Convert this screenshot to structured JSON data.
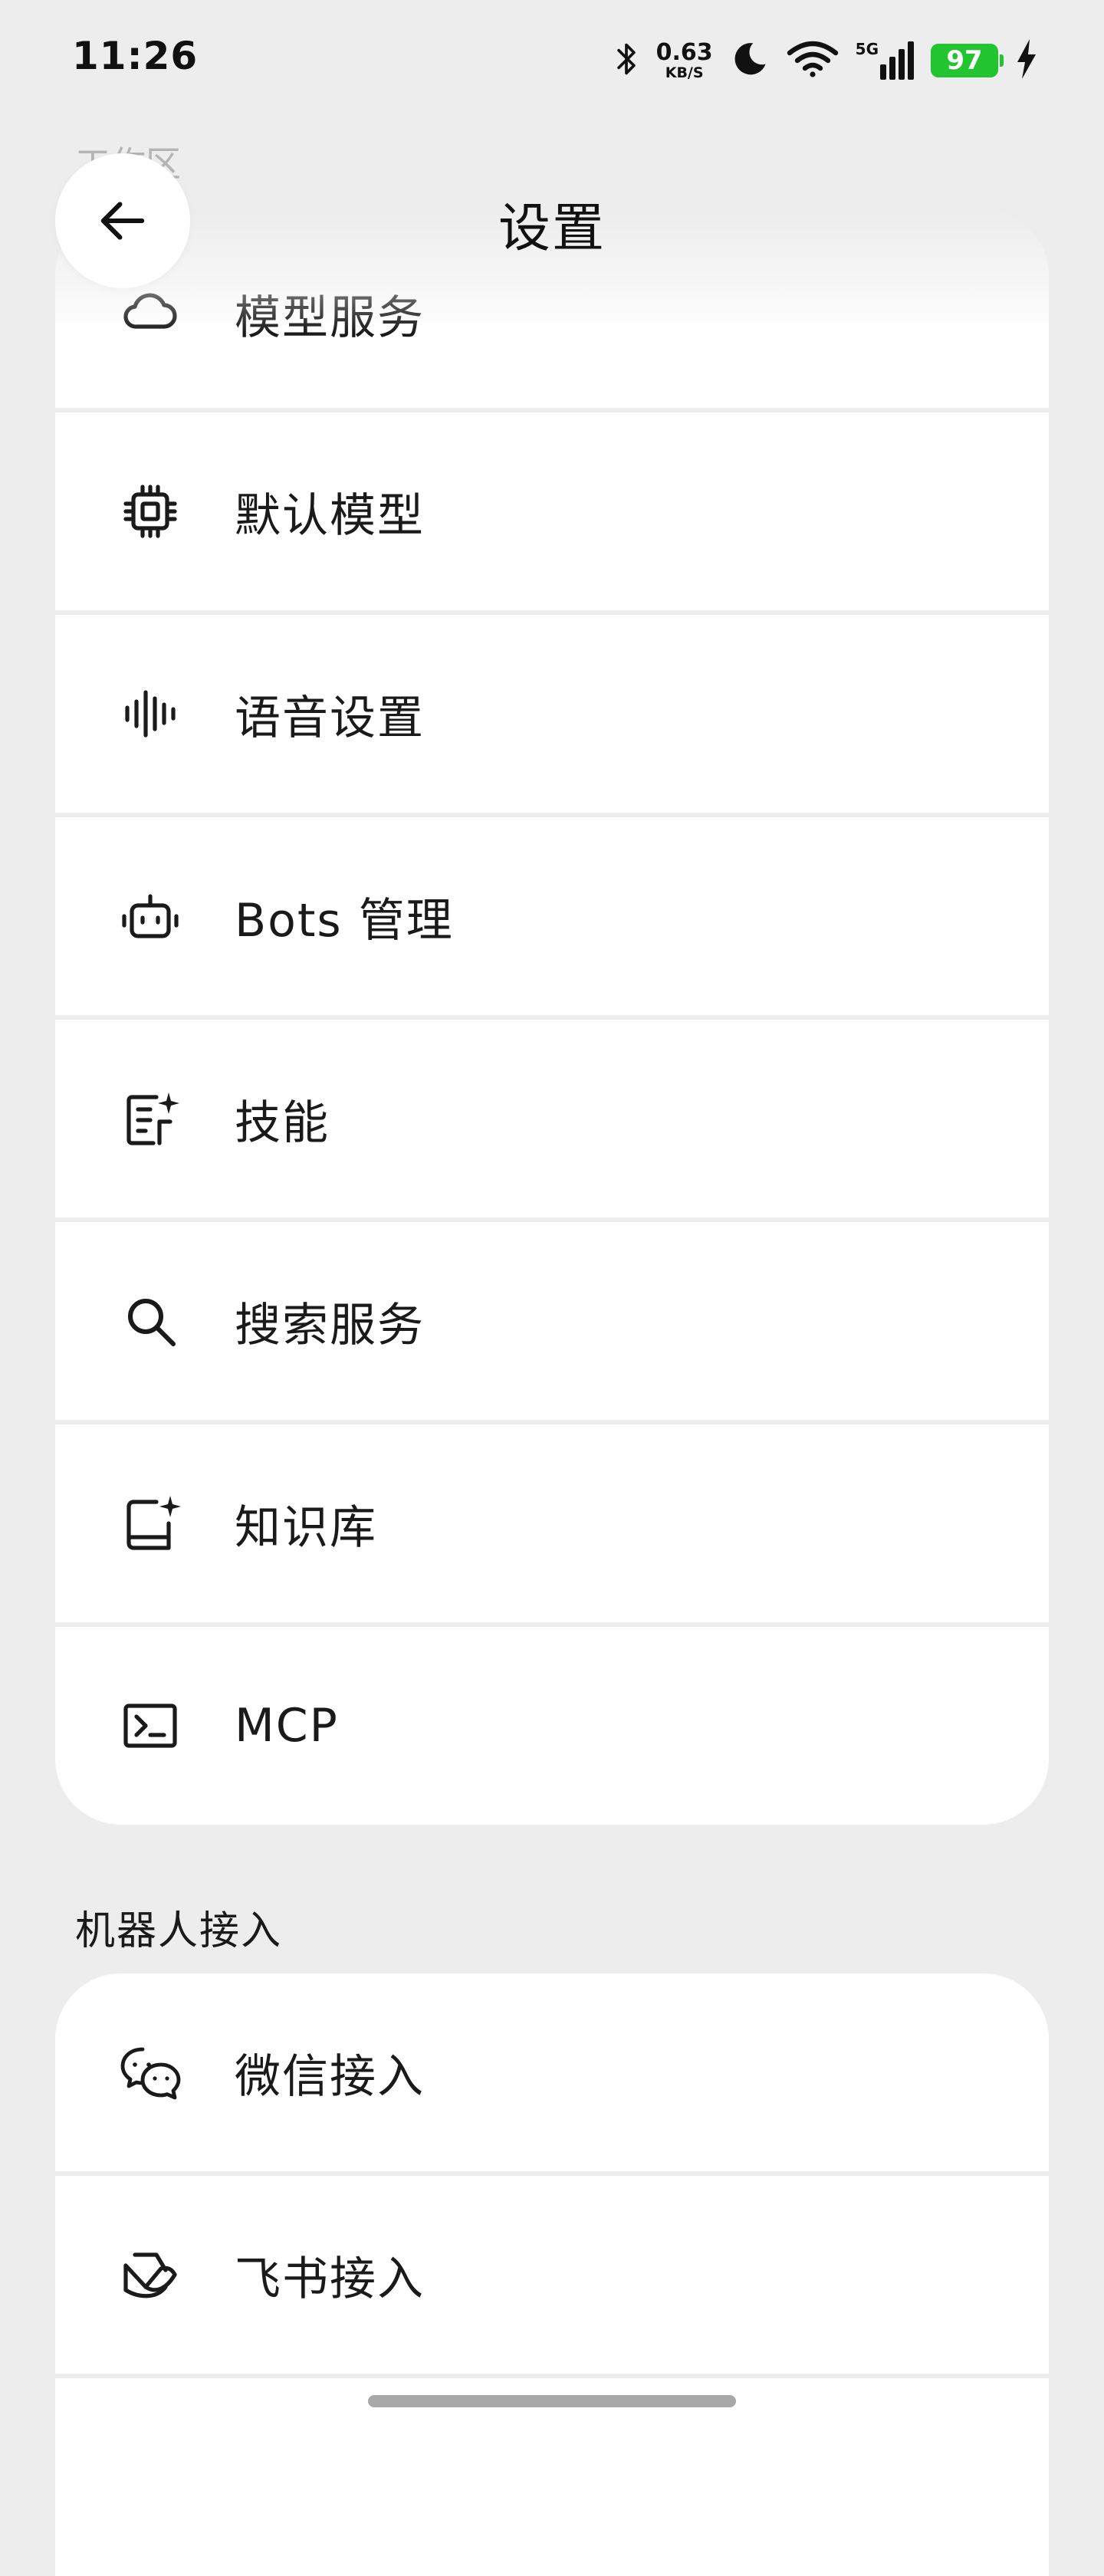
{
  "status_bar": {
    "time": "11:26",
    "net_speed_value": "0.63",
    "net_speed_unit": "KB/S",
    "network": "5G",
    "battery": "97"
  },
  "ghost_section_label": "工作区",
  "header": {
    "title": "设置"
  },
  "settings_items": [
    {
      "label": "模型服务",
      "icon": "cloud-icon"
    },
    {
      "label": "默认模型",
      "icon": "chip-icon"
    },
    {
      "label": "语音设置",
      "icon": "audio-wave-icon"
    },
    {
      "label": "Bots 管理",
      "icon": "robot-icon"
    },
    {
      "label": "技能",
      "icon": "skill-sparkle-icon"
    },
    {
      "label": "搜索服务",
      "icon": "search-icon"
    },
    {
      "label": "知识库",
      "icon": "knowledge-book-icon"
    },
    {
      "label": "MCP",
      "icon": "terminal-icon"
    }
  ],
  "bot_section": {
    "title": "机器人接入",
    "items": [
      {
        "label": "微信接入",
        "icon": "wechat-icon"
      },
      {
        "label": "飞书接入",
        "icon": "feishu-icon"
      },
      {
        "label": "",
        "icon": ""
      }
    ]
  }
}
